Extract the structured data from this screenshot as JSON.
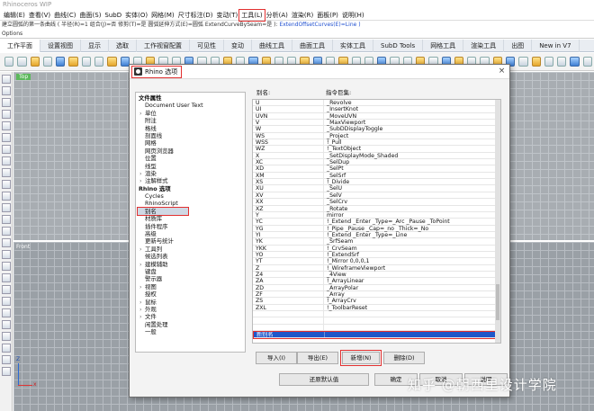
{
  "app": {
    "title": "Rhinoceros WIP"
  },
  "menu": [
    "编辑(E)",
    "查看(V)",
    "曲线(C)",
    "曲面(S)",
    "SubD",
    "实体(O)",
    "网格(M)",
    "尺寸标注(D)",
    "变动(T)",
    "工具(L)",
    "分析(A)",
    "渲染(R)",
    "面板(P)",
    "说明(H)"
  ],
  "menu_selected_index": 9,
  "command": {
    "line1_prefix": "建立圆弧的第一条曲线 ( 半径(R)=1 组合(J)=否 修剪(T)=是 圆弧延伸方式(E)=圆弧 ExtendCurveBySeam=是 ):",
    "line1_hl": "ExtendOffsetCurves(E)=Line )",
    "line2": "Options"
  },
  "tabs": [
    "工作平面",
    "设置视图",
    "显示",
    "选取",
    "工作视窗配置",
    "可见性",
    "变动",
    "曲线工具",
    "曲面工具",
    "实体工具",
    "SubD Tools",
    "网格工具",
    "渲染工具",
    "出图",
    "New in V7"
  ],
  "viewports": {
    "top": "Top",
    "front": "Front"
  },
  "axes": {
    "z": "Z",
    "x": "x"
  },
  "dialog": {
    "title": "Rhino 选项",
    "close": "×",
    "tree": [
      {
        "label": "文件属性",
        "hdr": true
      },
      {
        "label": "Document User Text"
      },
      {
        "label": "单位",
        "exp": true
      },
      {
        "label": "附注"
      },
      {
        "label": "格线"
      },
      {
        "label": "剖面线"
      },
      {
        "label": "网格"
      },
      {
        "label": "网页浏览器"
      },
      {
        "label": "位置"
      },
      {
        "label": "线型"
      },
      {
        "label": "渲染",
        "exp": true
      },
      {
        "label": "注解样式",
        "exp": true
      },
      {
        "label": "Rhino 选项",
        "hdr": true
      },
      {
        "label": "Cycles"
      },
      {
        "label": "RhinoScript"
      },
      {
        "label": "别名",
        "sel": true
      },
      {
        "label": "材质库"
      },
      {
        "label": "插件程序"
      },
      {
        "label": "高级"
      },
      {
        "label": "更新与统计"
      },
      {
        "label": "工具列",
        "exp": true
      },
      {
        "label": "候选列表"
      },
      {
        "label": "建模辅助",
        "exp": true
      },
      {
        "label": "键盘"
      },
      {
        "label": "警示器"
      },
      {
        "label": "视图",
        "exp": true
      },
      {
        "label": "授权"
      },
      {
        "label": "鼠标",
        "exp": true
      },
      {
        "label": "外观",
        "exp": true
      },
      {
        "label": "文件",
        "exp": true
      },
      {
        "label": "闲置处理"
      },
      {
        "label": "一般"
      }
    ],
    "col_alias": "别名:",
    "col_macro": "指令巨集:",
    "rows": [
      [
        "U",
        "_Revolve"
      ],
      [
        "UI",
        "_InsertKnot"
      ],
      [
        "UVN",
        "_MoveUVN"
      ],
      [
        "V",
        "_MaxViewport"
      ],
      [
        "W",
        "_SubDDisplayToggle"
      ],
      [
        "WS",
        "_Project"
      ],
      [
        "WSS",
        "!_Pull"
      ],
      [
        "WZ",
        "!_TextObject"
      ],
      [
        "X",
        "_SetDisplayMode_Shaded"
      ],
      [
        "XC",
        "_SelDup"
      ],
      [
        "XD",
        "_SelPt"
      ],
      [
        "XM",
        "_SelSrf"
      ],
      [
        "XS",
        "!_Divide"
      ],
      [
        "XU",
        "_SelU"
      ],
      [
        "XV",
        "_SelV"
      ],
      [
        "XX",
        "_SelCrv"
      ],
      [
        "XZ",
        "_Rotate"
      ],
      [
        "Y",
        "mirror"
      ],
      [
        "YC",
        "!_Extend _Enter _Type=_Arc _Pause _ToPoint"
      ],
      [
        "YG",
        "!_Pipe _Pause _Cap=_no _Thick=_No"
      ],
      [
        "YI",
        "!_Extend _Enter _Type=_Line"
      ],
      [
        "YK",
        "_SrfSeam"
      ],
      [
        "YKK",
        "!_CrvSeam"
      ],
      [
        "YO",
        "!_ExtendSrf"
      ],
      [
        "YT",
        "!_Mirror 0,0,0,1"
      ],
      [
        "Z",
        "!_WireframeViewport"
      ],
      [
        "Z4",
        "_4View"
      ],
      [
        "ZA",
        "!_ArrayLinear"
      ],
      [
        "ZD",
        "_ArrayPolar"
      ],
      [
        "ZF",
        "_Array"
      ],
      [
        "ZS",
        "!_ArrayCrv"
      ],
      [
        "ZXL",
        "!_ToolbarReset"
      ]
    ],
    "new_row": [
      "新别名",
      ""
    ],
    "buttons": {
      "import": "导入(I)",
      "export": "导出(E)",
      "new": "新增(N)",
      "delete": "删除(D)",
      "restore": "还原默认值",
      "ok": "确定",
      "cancel": "取消",
      "help": "说明"
    }
  },
  "watermark": "知乎 @朝西里设计学院"
}
